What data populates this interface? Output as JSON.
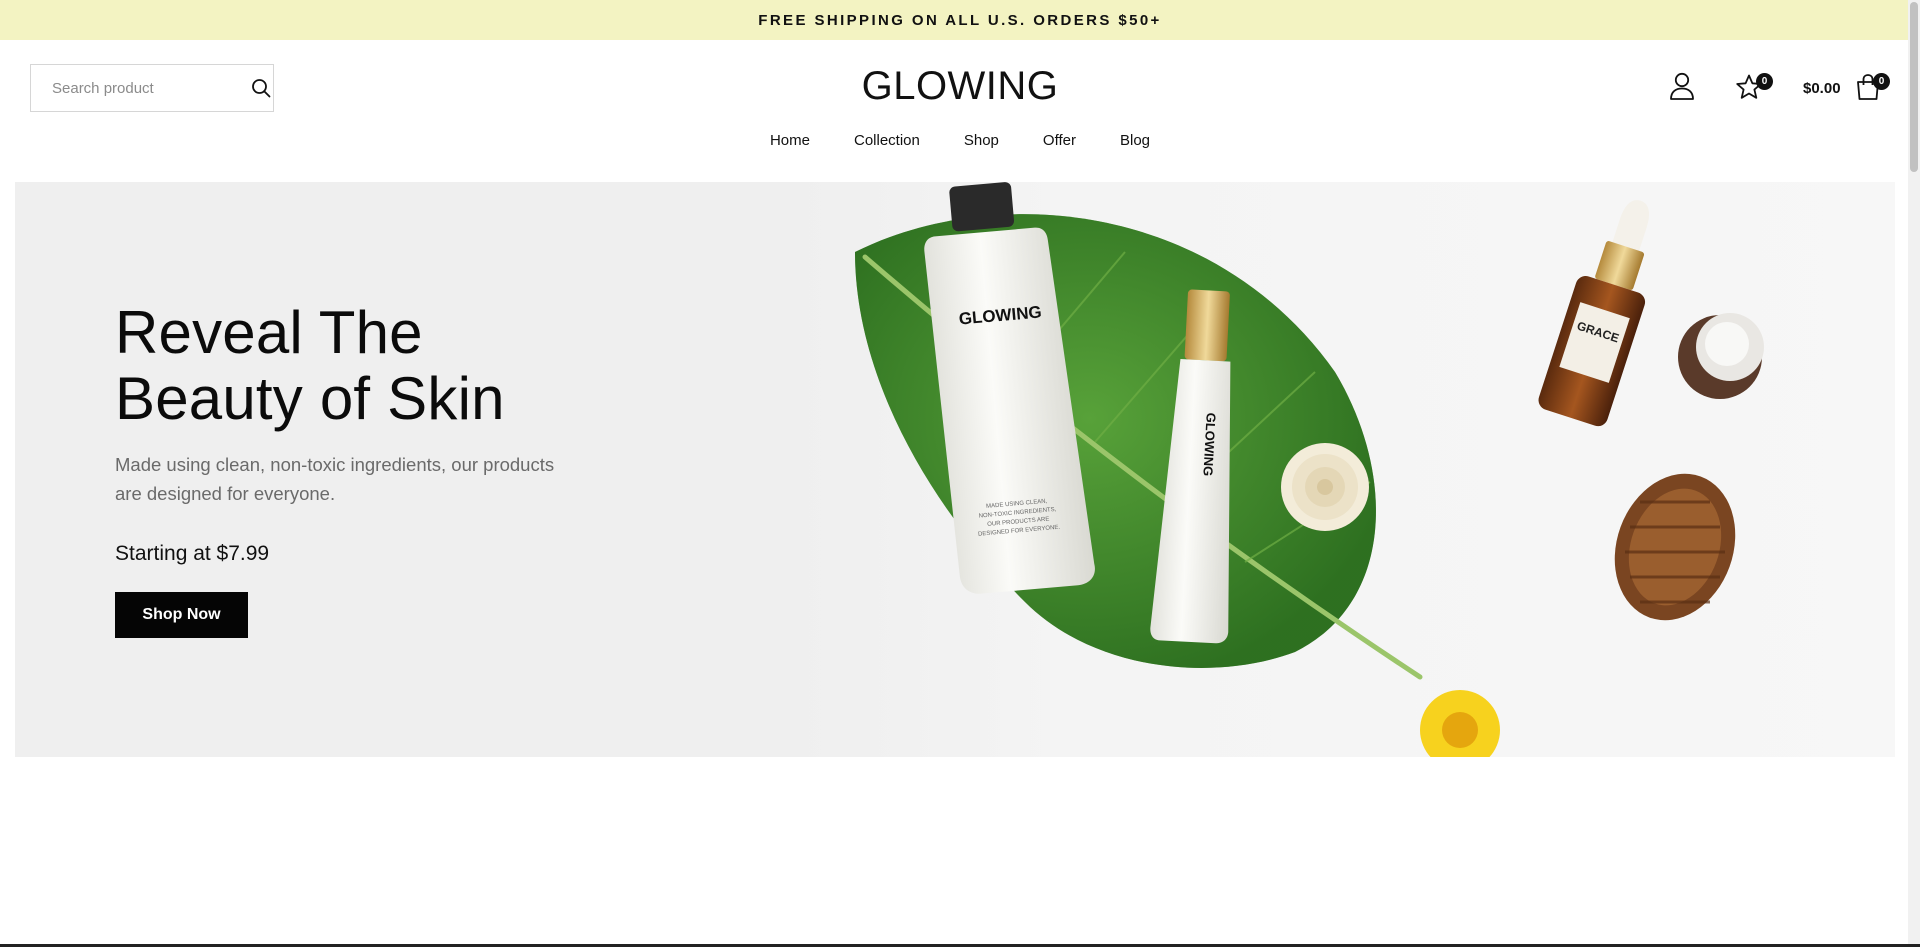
{
  "announcement": {
    "text": "FREE SHIPPING ON ALL U.S. ORDERS $50+"
  },
  "search": {
    "placeholder": "Search product",
    "value": "",
    "icon": "search-icon"
  },
  "brand": {
    "logo": "GLOWING"
  },
  "header": {
    "account_icon": "user-icon",
    "wishlist": {
      "icon": "star-icon",
      "count": "0"
    },
    "cart": {
      "total": "$0.00",
      "icon": "shopping-bag-icon",
      "count": "0"
    }
  },
  "nav": {
    "items": [
      {
        "label": "Home"
      },
      {
        "label": "Collection"
      },
      {
        "label": "Shop"
      },
      {
        "label": "Offer"
      },
      {
        "label": "Blog"
      }
    ]
  },
  "hero": {
    "title_line1": "Reveal The",
    "title_line2": "Beauty of Skin",
    "description": "Made using clean, non-toxic ingredients, our products are designed for everyone.",
    "price": "Starting at $7.99",
    "cta": "Shop Now",
    "products": {
      "tube_large_brand": "GLOWING",
      "tube_large_caption": "MADE USING CLEAN, NON-TOXIC INGREDIENTS, OUR PRODUCTS ARE DESIGNED FOR EVERYONE.",
      "tube_small_brand": "GLOWING",
      "bottle_label": "GRACE"
    }
  },
  "colors": {
    "announcement_bg": "#f3f3c2",
    "hero_bg": "#efefef",
    "button_bg": "#050505",
    "leaf_green": "#3f8a2c"
  }
}
